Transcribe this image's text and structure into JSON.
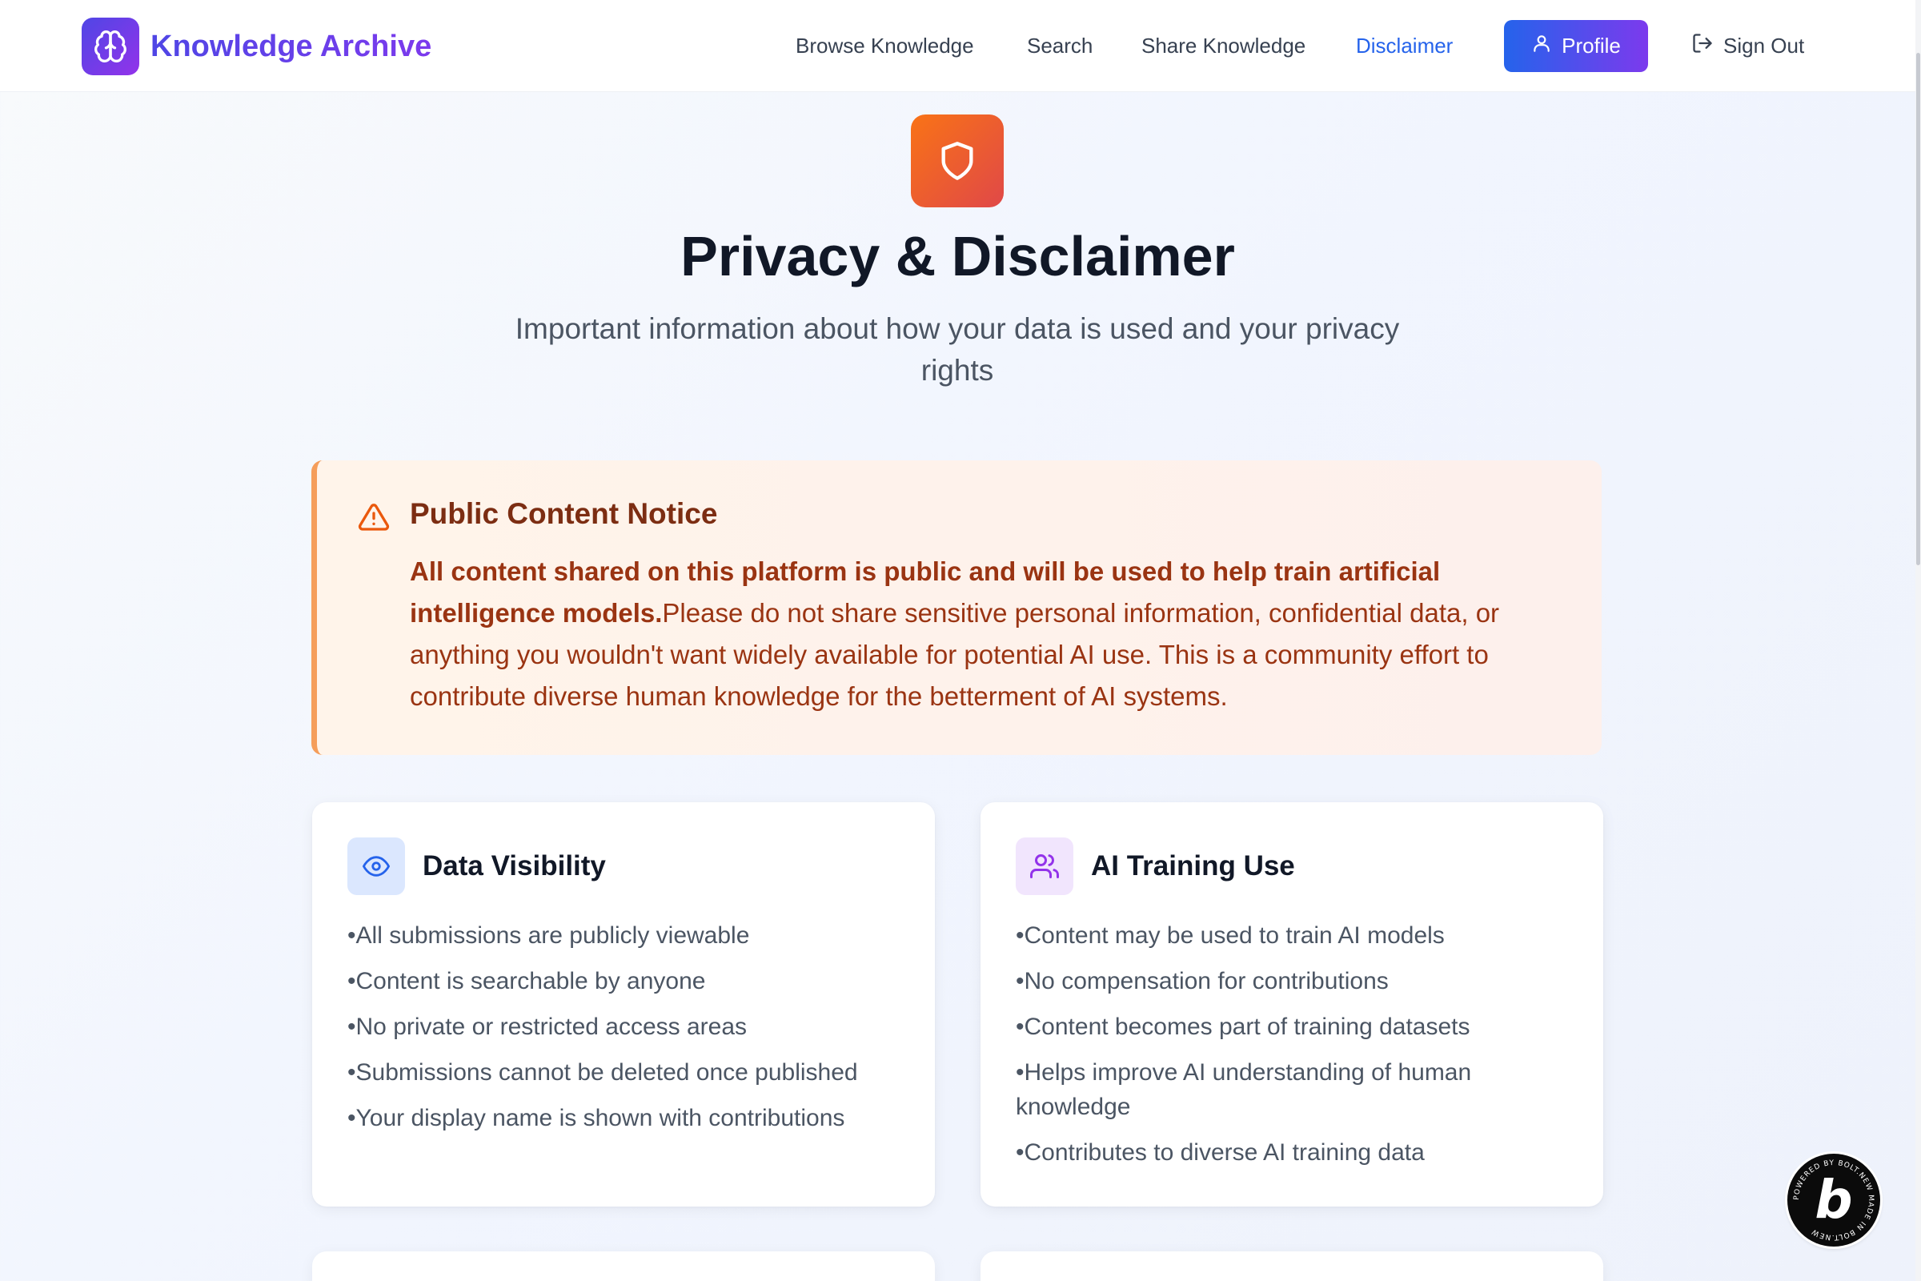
{
  "header": {
    "brand_name": "Knowledge Archive",
    "nav": [
      {
        "label": "Browse Knowledge"
      },
      {
        "label": "Search"
      },
      {
        "label": "Share Knowledge"
      },
      {
        "label": "Disclaimer",
        "active": true
      }
    ],
    "profile_label": "Profile",
    "signout_label": "Sign Out"
  },
  "hero": {
    "icon": "shield-icon",
    "title": "Privacy & Disclaimer",
    "subtitle": "Important information about how your data is used and your privacy rights"
  },
  "notice": {
    "icon": "warning-triangle-icon",
    "title": "Public Content Notice",
    "bold_text": "All content shared on this platform is public and will be used to help train artificial intelligence models.",
    "body_text": "Please do not share sensitive personal information, confidential data, or anything you wouldn't want widely available for potential AI use. This is a community effort to contribute diverse human knowledge for the betterment of AI systems."
  },
  "cards": [
    {
      "icon": "eye-icon",
      "title": "Data Visibility",
      "items": [
        "All submissions are publicly viewable",
        "Content is searchable by anyone",
        "No private or restricted access areas",
        "Submissions cannot be deleted once published",
        "Your display name is shown with contributions"
      ]
    },
    {
      "icon": "users-icon",
      "title": "AI Training Use",
      "items": [
        "Content may be used to train AI models",
        "No compensation for contributions",
        "Content becomes part of training datasets",
        "Helps improve AI understanding of human knowledge",
        "Contributes to diverse AI training data"
      ]
    }
  ],
  "badge": {
    "letter": "b",
    "ring_text": "POWERED BY BOLT.NEW MADE IN BOLT.NEW"
  },
  "colors": {
    "accent": "#2563eb",
    "brand_gradient_start": "#4f46e5",
    "brand_gradient_end": "#7c3aed",
    "warning": "#9a3412",
    "hero_icon_start": "#f97316",
    "hero_icon_end": "#e04848"
  }
}
